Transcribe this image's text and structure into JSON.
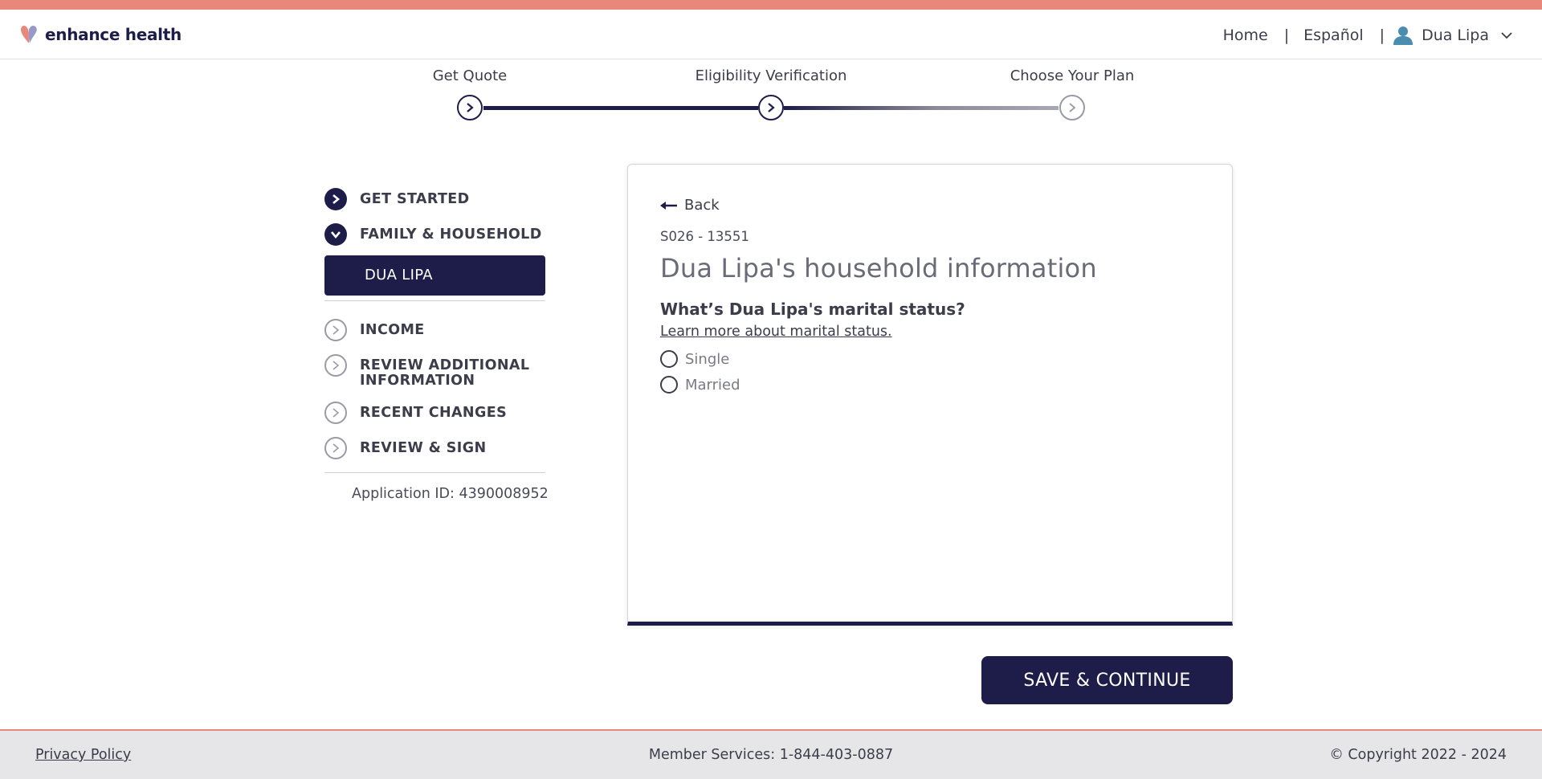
{
  "brand": {
    "name": "enhance health",
    "accent_color": "#e8887a",
    "primary_color": "#1e1d4a"
  },
  "header": {
    "nav": {
      "home": "Home",
      "language": "Español",
      "separator": "|",
      "user_name": "Dua Lipa"
    }
  },
  "stepper": {
    "steps": [
      {
        "label": "Get Quote",
        "status": "active"
      },
      {
        "label": "Eligibility Verification",
        "status": "active"
      },
      {
        "label": "Choose Your Plan",
        "status": "inactive"
      }
    ]
  },
  "sidebar": {
    "items": [
      {
        "label": "GET STARTED",
        "icon": "chevron-right-icon"
      },
      {
        "label": "FAMILY & HOUSEHOLD",
        "icon": "chevron-down-icon"
      },
      {
        "label": "INCOME",
        "icon": "chevron-right-icon"
      },
      {
        "label": "REVIEW ADDITIONAL INFORMATION",
        "icon": "chevron-right-icon"
      },
      {
        "label": "RECENT CHANGES",
        "icon": "chevron-right-icon"
      },
      {
        "label": "REVIEW & SIGN",
        "icon": "chevron-right-icon"
      }
    ],
    "selected_member": "DUA LIPA",
    "application_id": "Application ID: 4390008952"
  },
  "card": {
    "back_label": "Back",
    "form_id": "S026 - 13551",
    "title": "Dua Lipa's household information",
    "question": "What’s Dua Lipa's marital status?",
    "learn_more": "Learn more about marital status.",
    "options": [
      {
        "label": "Single",
        "selected": false
      },
      {
        "label": "Married",
        "selected": false
      }
    ]
  },
  "actions": {
    "save_label": "SAVE & CONTINUE"
  },
  "footer": {
    "privacy": "Privacy Policy",
    "member_services": "Member Services: 1-844-403-0887",
    "copyright": "© Copyright 2022 - 2024"
  }
}
